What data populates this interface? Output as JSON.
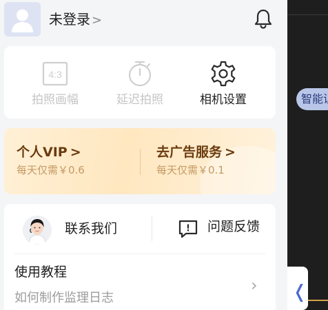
{
  "header": {
    "login_text": "未登录",
    "login_chevron": ">",
    "avatar_icon": "user-avatar-icon",
    "bell_icon": "bell-icon"
  },
  "tools": [
    {
      "label": "拍照画幅",
      "icon_text": "4:3",
      "icon": "aspect-ratio-icon",
      "state": "disabled"
    },
    {
      "label": "延迟拍照",
      "icon": "timer-icon",
      "state": "disabled"
    },
    {
      "label": "相机设置",
      "icon": "gear-icon",
      "state": "active"
    }
  ],
  "promo": {
    "vip": {
      "title": "个人VIP",
      "chevron": ">",
      "subtitle": "每天仅需￥0.6"
    },
    "adfree": {
      "title": "去广告服务",
      "chevron": ">",
      "subtitle": "每天仅需￥0.1"
    }
  },
  "support": {
    "contact_label": "联系我们",
    "feedback_label": "问题反馈",
    "feedback_icon_text": "!"
  },
  "tutorial": {
    "title": "使用教程",
    "subtitle": "如何制作监理日志",
    "chevron": "›"
  },
  "right_pane": {
    "chip_text": "智能识",
    "collapse_glyph": "❬"
  },
  "colors": {
    "accent": "#4a6ad0",
    "vip_text": "#6b3b0f",
    "vip_sub": "#c49a64",
    "disabled": "#c5c5c5"
  }
}
